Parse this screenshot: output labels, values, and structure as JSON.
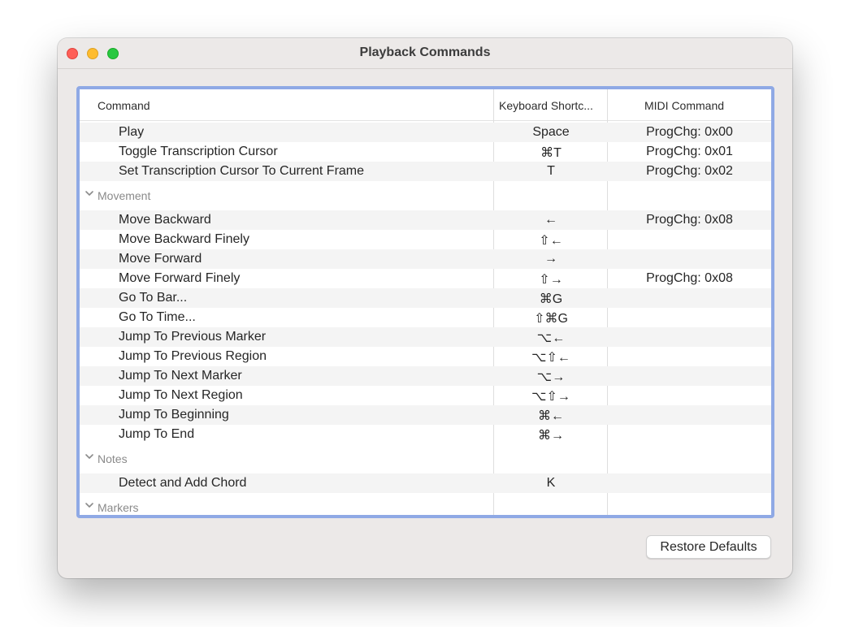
{
  "window": {
    "title": "Playback Commands"
  },
  "table": {
    "columns": [
      "Command",
      "Keyboard Shortc...",
      "MIDI Command"
    ],
    "top_rows": [
      {
        "command": "Play",
        "key": "Space",
        "midi": "ProgChg: 0x00"
      },
      {
        "command": "Toggle Transcription Cursor",
        "key": "⌘T",
        "midi": "ProgChg: 0x01"
      },
      {
        "command": "Set Transcription Cursor To Current Frame",
        "key": "T",
        "midi": "ProgChg: 0x02"
      }
    ],
    "groups": [
      {
        "name": "Movement",
        "rows": [
          {
            "command": "Move Backward",
            "key": "←",
            "midi": "ProgChg: 0x08"
          },
          {
            "command": "Move Backward Finely",
            "key": "⇧←",
            "midi": ""
          },
          {
            "command": "Move Forward",
            "key": "→",
            "midi": ""
          },
          {
            "command": "Move Forward Finely",
            "key": "⇧→",
            "midi": "ProgChg: 0x08"
          },
          {
            "command": "Go To Bar...",
            "key": "⌘G",
            "midi": ""
          },
          {
            "command": "Go To Time...",
            "key": "⇧⌘G",
            "midi": ""
          },
          {
            "command": "Jump To Previous Marker",
            "key": "⌥←",
            "midi": ""
          },
          {
            "command": "Jump To Previous Region",
            "key": "⌥⇧←",
            "midi": ""
          },
          {
            "command": "Jump To Next Marker",
            "key": "⌥→",
            "midi": ""
          },
          {
            "command": "Jump To Next Region",
            "key": "⌥⇧→",
            "midi": ""
          },
          {
            "command": "Jump To Beginning",
            "key": "⌘←",
            "midi": ""
          },
          {
            "command": "Jump To End",
            "key": "⌘→",
            "midi": ""
          }
        ]
      },
      {
        "name": "Notes",
        "rows": [
          {
            "command": "Detect and Add Chord",
            "key": "K",
            "midi": ""
          }
        ]
      },
      {
        "name": "Markers",
        "rows": []
      }
    ]
  },
  "footer": {
    "restore_label": "Restore Defaults"
  },
  "icons": {
    "close": "window-close-icon",
    "minimize": "window-minimize-icon",
    "zoom": "window-zoom-icon",
    "disclosure": "chevron-down-icon"
  },
  "colors": {
    "selection_border": "#8fa9e5",
    "close": "#fe5f57",
    "minimize": "#febc2e",
    "zoom": "#28c840"
  }
}
